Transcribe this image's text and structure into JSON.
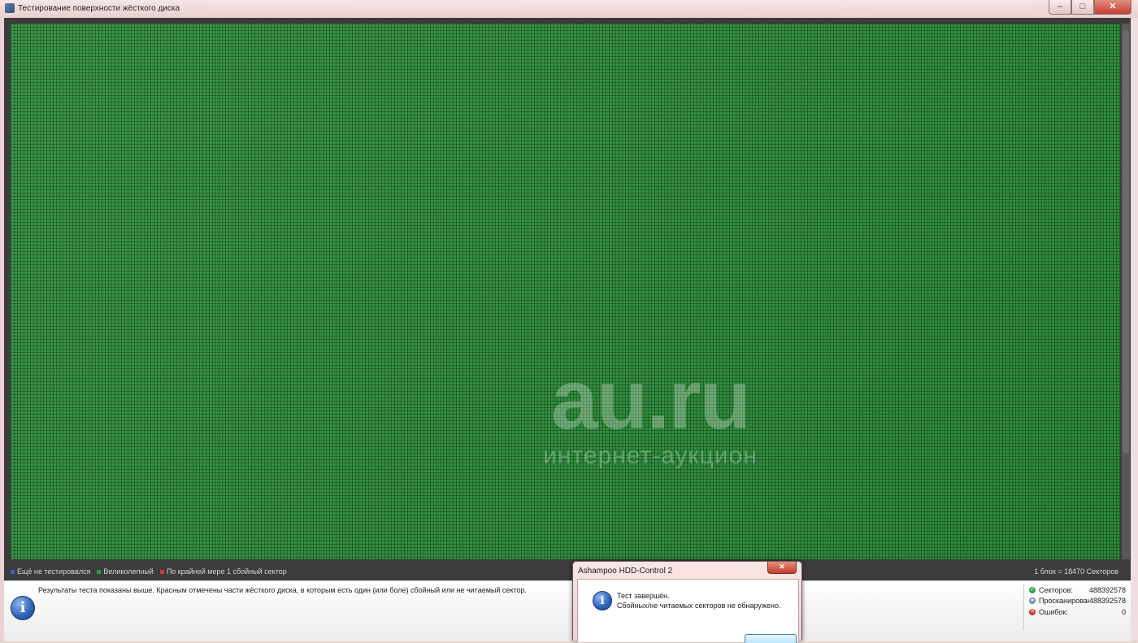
{
  "window": {
    "title": "Тестирование поверхности жёсткого диска",
    "controls": {
      "minimize": "–",
      "maximize": "□",
      "close": "✕"
    }
  },
  "surface_grid": {
    "color": "#2e8f3b",
    "watermark": {
      "main": "au.ru",
      "sub": "интернет-аукцион"
    }
  },
  "legend": {
    "items": [
      {
        "label": "Ещё не тестировался",
        "color": "#3a5fbf"
      },
      {
        "label": "Великолепный",
        "color": "#2e9a3c"
      },
      {
        "label": "По крайней мере 1 сбойный сектор",
        "color": "#d43a2a"
      }
    ],
    "block_info": "1 блок = 18470 Секторов"
  },
  "info_panel": {
    "message": "Результаты теста показаны выше. Красным отмечены части жёсткого диска, в которым есть один (или боле) сбойный или не читаемый сектор.",
    "icon": "info-icon"
  },
  "stats": [
    {
      "label": "Секторов:",
      "value": "488392578",
      "icon": "check-circle-icon",
      "color": "#3fa54a"
    },
    {
      "label": "Просканирован:",
      "value": "488392578",
      "icon": "magnifier-icon",
      "color": "#7a8fa8"
    },
    {
      "label": "Ошибок:",
      "value": "0",
      "icon": "error-icon",
      "color": "#d23a2a"
    }
  ],
  "dialog": {
    "title": "Ashampoo HDD-Control 2",
    "close": "✕",
    "line1": "Тест завершён.",
    "line2": "Сбойных/не читаемых секторов не обнаружено."
  }
}
